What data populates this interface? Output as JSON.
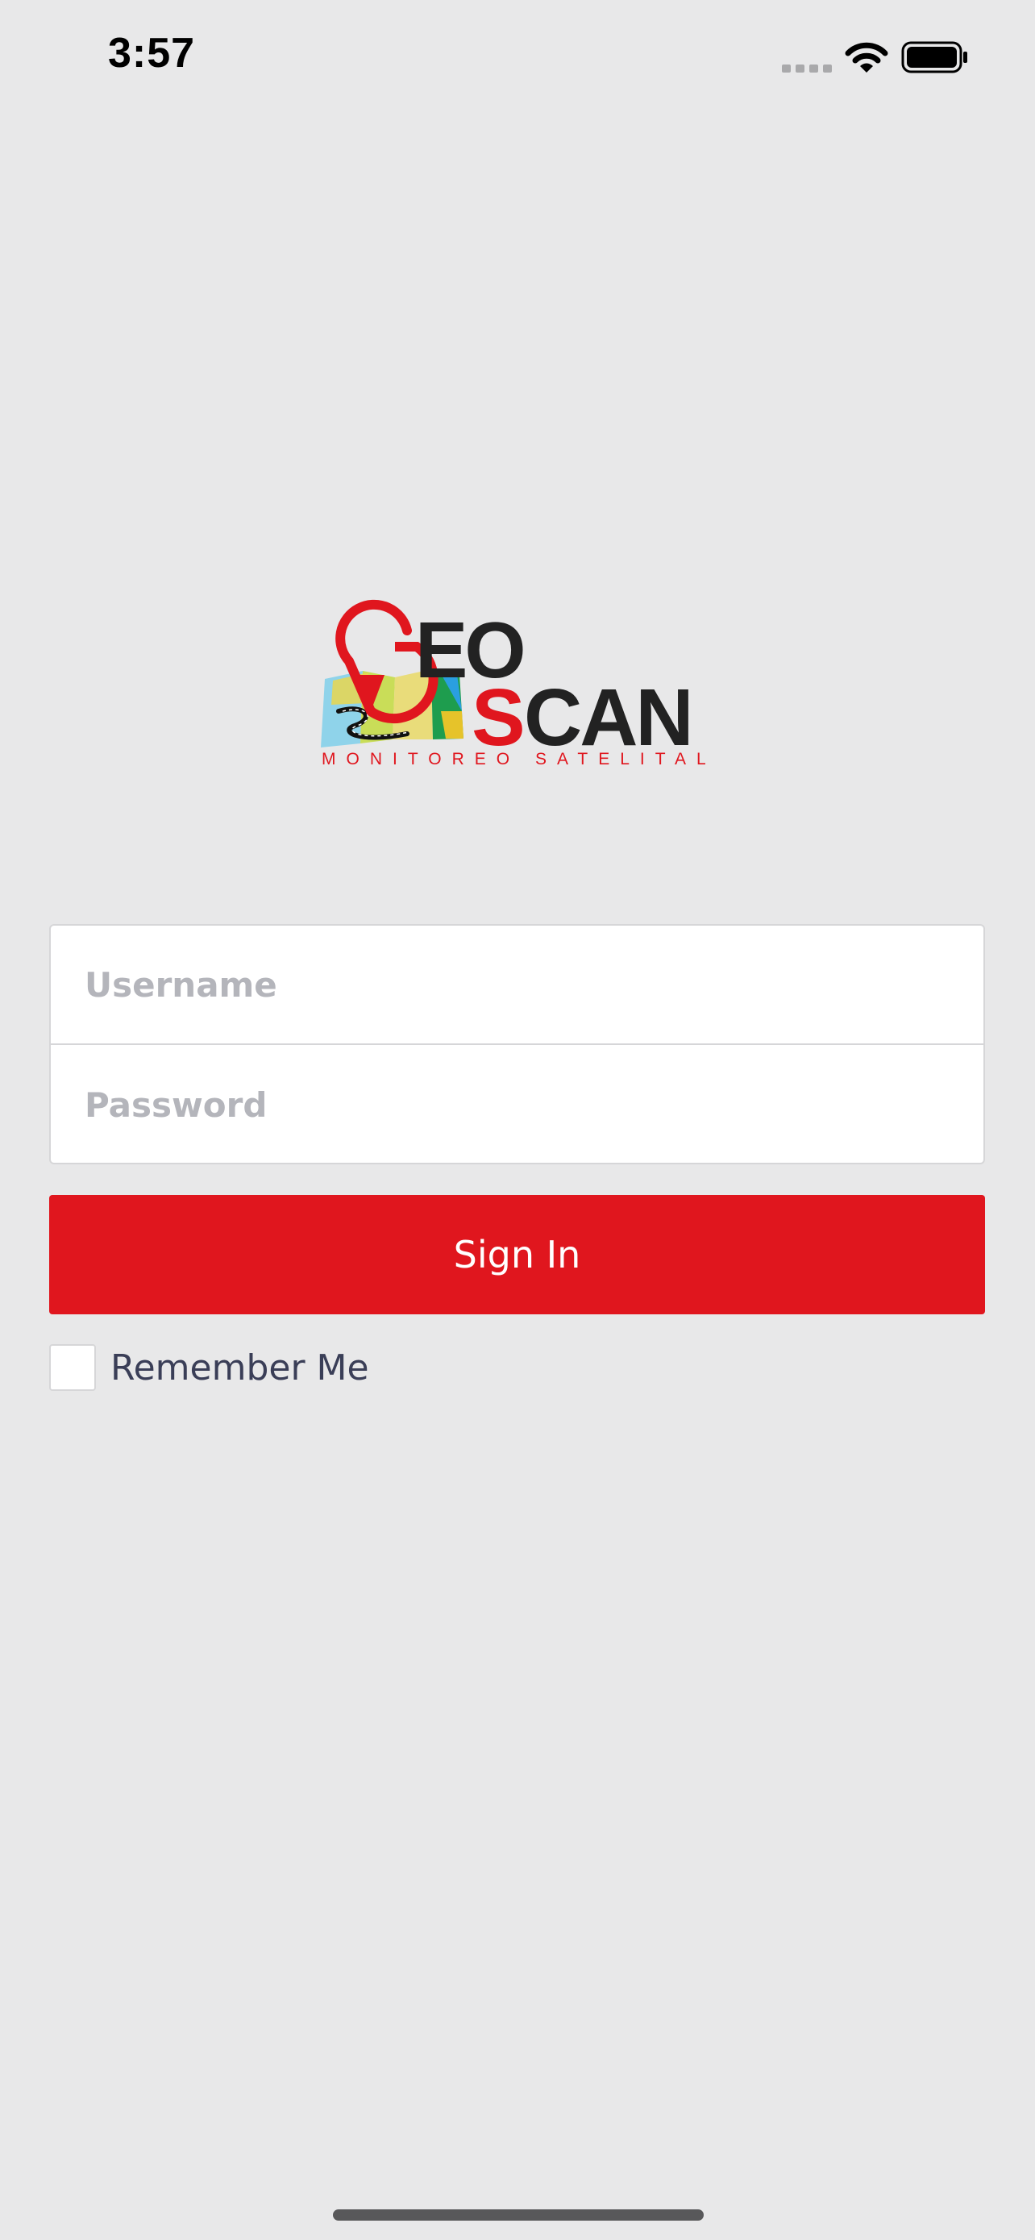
{
  "status_bar": {
    "time": "3:57",
    "icons": [
      "cellular-signal-icon",
      "wifi-icon",
      "battery-icon"
    ]
  },
  "logo": {
    "word_top": "EO",
    "word_bottom": "CAN",
    "tagline": "MONITOREO SATELITAL",
    "colors": {
      "red": "#e0161e",
      "dark": "#222222"
    }
  },
  "form": {
    "username_placeholder": "Username",
    "password_placeholder": "Password",
    "signin_label": "Sign In",
    "remember_label": "Remember Me",
    "remember_checked": false
  },
  "colors": {
    "background": "#e8e8e9",
    "accent": "#e0161e",
    "placeholder": "#b4b5bb",
    "label": "#3a3e57"
  }
}
